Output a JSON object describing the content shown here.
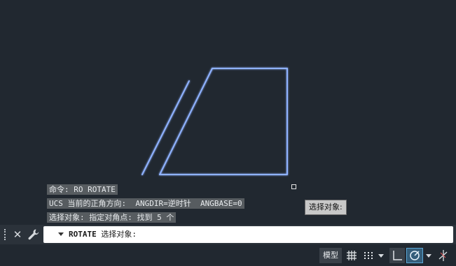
{
  "history": {
    "line1": "命令: RO ROTATE",
    "line2": "UCS 当前的正角方向:  ANGDIR=逆时针  ANGBASE=0",
    "line3": "选择对象: 指定对角点: 找到 5 个"
  },
  "tooltip": {
    "text": "选择对象:"
  },
  "command_line": {
    "command": "ROTATE",
    "prompt": " 选择对象:"
  },
  "status_bar": {
    "model_label": "模型",
    "icons": [
      "grid-icon",
      "snap-icon",
      "ortho-icon",
      "polar-icon",
      "isodraft-icon"
    ],
    "polar_active": true
  },
  "colors": {
    "background": "#212830",
    "selected_geometry": "#8fb2ff",
    "geometry_glow": "#3f63d8",
    "history_background": "#575c60",
    "command_input_background": "#ffffff",
    "active_toggle": "#5aa7d6"
  },
  "icons": {
    "close": "close-icon",
    "customize": "wrench-icon",
    "recent_commands": "chevron-down-icon"
  }
}
